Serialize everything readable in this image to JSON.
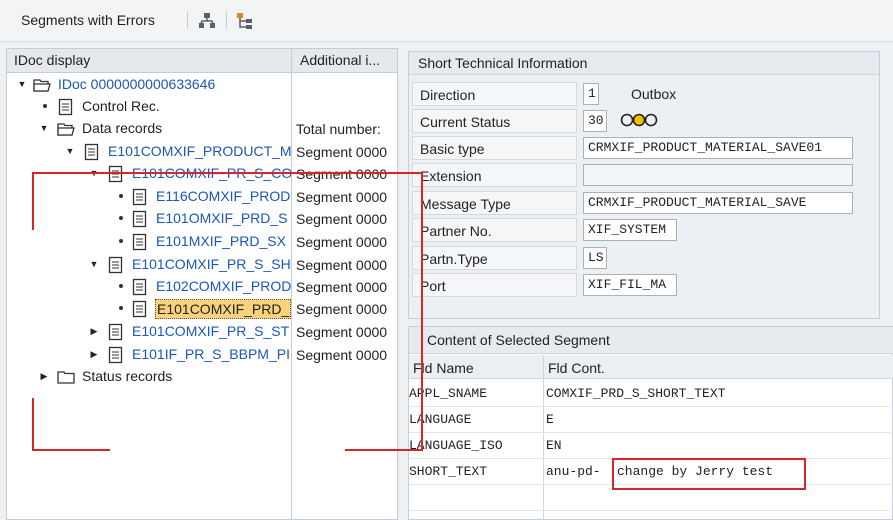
{
  "toolbar": {
    "title": "Segments with Errors",
    "icons": [
      "hierarchy-icon",
      "tree-structure-icon"
    ]
  },
  "tree": {
    "headers": {
      "col1": "IDoc display",
      "col2": "Additional i..."
    },
    "rows": [
      {
        "label": "IDoc 0000000000633646",
        "addl": ""
      },
      {
        "label": "Control Rec.",
        "addl": ""
      },
      {
        "label": "Data records",
        "addl": "Total number: "
      },
      {
        "label": "E101COMXIF_PRODUCT_M",
        "addl": "Segment 0000"
      },
      {
        "label": "E101COMXIF_PR_S_CO",
        "addl": "Segment 0000"
      },
      {
        "label": "E116COMXIF_PROD",
        "addl": "Segment 0000"
      },
      {
        "label": "E101OMXIF_PRD_S",
        "addl": "Segment 0000"
      },
      {
        "label": "E101MXIF_PRD_SX",
        "addl": "Segment 0000"
      },
      {
        "label": "E101COMXIF_PR_S_SH",
        "addl": "Segment 0000"
      },
      {
        "label": "E102COMXIF_PROD",
        "addl": "Segment 0000"
      },
      {
        "label": "E101COMXIF_PRD_",
        "addl": "Segment 0000"
      },
      {
        "label": "E101COMXIF_PR_S_ST",
        "addl": "Segment 0000"
      },
      {
        "label": "E101IF_PR_S_BBPM_PI",
        "addl": "Segment 0000"
      },
      {
        "label": "Status records",
        "addl": ""
      }
    ]
  },
  "tech_info": {
    "title": "Short Technical Information",
    "fields": [
      {
        "label": "Direction",
        "value": "1",
        "extra": "Outbox"
      },
      {
        "label": "Current Status",
        "value": "30",
        "extra": ""
      },
      {
        "label": "Basic type",
        "value": "CRMXIF_PRODUCT_MATERIAL_SAVE01",
        "extra": ""
      },
      {
        "label": "Extension",
        "value": "",
        "extra": ""
      },
      {
        "label": "Message Type",
        "value": "CRMXIF_PRODUCT_MATERIAL_SAVE",
        "extra": ""
      },
      {
        "label": "Partner No.",
        "value": "XIF_SYSTEM",
        "extra": ""
      },
      {
        "label": "Partn.Type",
        "value": "LS",
        "extra": ""
      },
      {
        "label": "Port",
        "value": "XIF_FIL_MA",
        "extra": ""
      }
    ]
  },
  "segment_content": {
    "title": "Content of Selected Segment",
    "headers": {
      "name": "Fld Name",
      "content": "Fld Cont."
    },
    "rows": [
      {
        "name": "APPL_SNAME",
        "content": "COMXIF_PRD_S_SHORT_TEXT",
        "content_highlight": ""
      },
      {
        "name": "LANGUAGE",
        "content": "E",
        "content_highlight": ""
      },
      {
        "name": "LANGUAGE_ISO",
        "content": "EN",
        "content_highlight": ""
      },
      {
        "name": "SHORT_TEXT",
        "content": "anu-pd-",
        "content_highlight": "change by Jerry test"
      }
    ]
  },
  "colors": {
    "accent_blue": "#1a57b8",
    "selection": "#fbd27c",
    "annotation_red": "#d6262b"
  }
}
